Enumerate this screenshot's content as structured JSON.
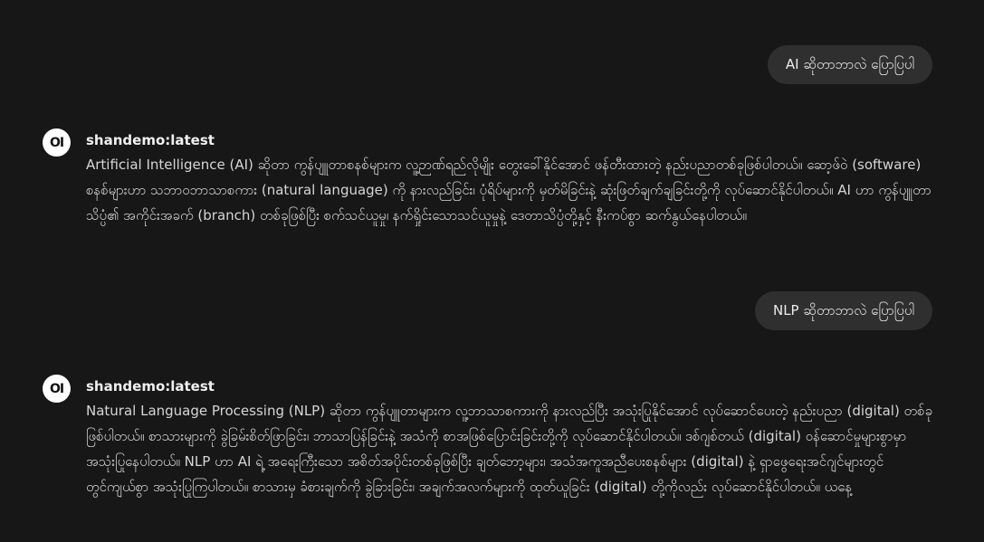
{
  "conversation": {
    "user_messages": [
      "AI ဆိုတာဘာလဲ ပြောပြပါ",
      "NLP ဆိုတာဘာလဲ ပြောပြပါ"
    ],
    "assistant": {
      "avatar_text": "OI",
      "model_name": "shandemo:latest",
      "replies": [
        "Artificial Intelligence (AI) ဆိုတာ ကွန်ပျူတာစနစ်များက လူ့ဉာဏ်ရည်လိုမျိုး တွေးခေါ်နိုင်အောင် ဖန်တီးထားတဲ့ နည်းပညာတစ်ခုဖြစ်ပါတယ်။ ဆော့ဖ်ဝဲ (software) စနစ်များဟာ သဘာဝဘာသာစကား (natural language) ကို နားလည်ခြင်း၊ ပုံရိပ်များကို မှတ်မိခြင်းနဲ့ ဆုံးဖြတ်ချက်ချခြင်းတို့ကို လုပ်ဆောင်နိုင်ပါတယ်။ AI ဟာ ကွန်ပျူတာသိပ္ပံ၏ အကိုင်းအခက် (branch) တစ်ခုဖြစ်ပြီး စက်သင်ယူမှု၊ နက်ရှိုင်းသောသင်ယူမှုနဲ့ ဒေတာသိပ္ပံတို့နှင့် နီးကပ်စွာ ဆက်နွယ်နေပါတယ်။",
        "Natural Language Processing (NLP) ဆိုတာ ကွန်ပျူတာများက လူ့ဘာသာစကားကို နားလည်ပြီး အသုံးပြုနိုင်အောင် လုပ်ဆောင်ပေးတဲ့ နည်းပညာ (digital) တစ်ခုဖြစ်ပါတယ်။ စာသားများကို ခွဲခြမ်းစိတ်ဖြာခြင်း၊ ဘာသာပြန်ခြင်းနဲ့ အသံကို စာအဖြစ်ပြောင်းခြင်းတို့ကို လုပ်ဆောင်နိုင်ပါတယ်။ ဒစ်ဂျစ်တယ် (digital) ဝန်ဆောင်မှုများစွာမှာ အသုံးပြုနေပါတယ်။ NLP ဟာ AI ရဲ့ အရေးကြီးသော အစိတ်အပိုင်းတစ်ခုဖြစ်ပြီး ချတ်ဘော့များ၊ အသံအကူအညီပေးစနစ်များ (digital) နဲ့ ရှာဖွေရေးအင်ဂျင်များတွင် တွင်ကျယ်စွာ အသုံးပြုကြပါတယ်။ စာသားမှ ခံစားချက်ကို ခွဲခြားခြင်း၊ အချက်အလက်များကို ထုတ်ယူခြင်း (digital) တို့ကိုလည်း လုပ်ဆောင်နိုင်ပါတယ်။ ယနေ့"
      ]
    }
  }
}
